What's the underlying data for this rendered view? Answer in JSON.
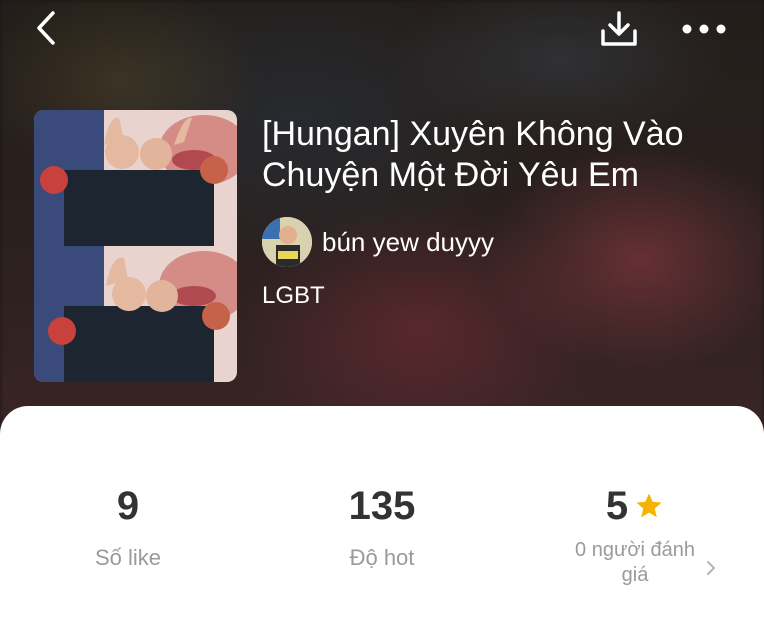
{
  "header": {
    "back_icon": "chevron-left-icon",
    "download_icon": "download-icon",
    "more_icon": "more-horizontal-icon"
  },
  "story": {
    "title": "[Hungan] Xuyên Không Vào Chuyện Một Đời Yêu Em",
    "author": "bún yew duyyy",
    "tag": "LGBT"
  },
  "stats": {
    "likes": {
      "value": "9",
      "label": "Số like"
    },
    "hot": {
      "value": "135",
      "label": "Độ hot"
    },
    "rating": {
      "value": "5",
      "label": "0 người đánh giá",
      "icon": "star-icon"
    }
  },
  "colors": {
    "star": "#f5b400",
    "card_bg": "#ffffff",
    "value_text": "#333333",
    "label_text": "#9a9a9a"
  }
}
